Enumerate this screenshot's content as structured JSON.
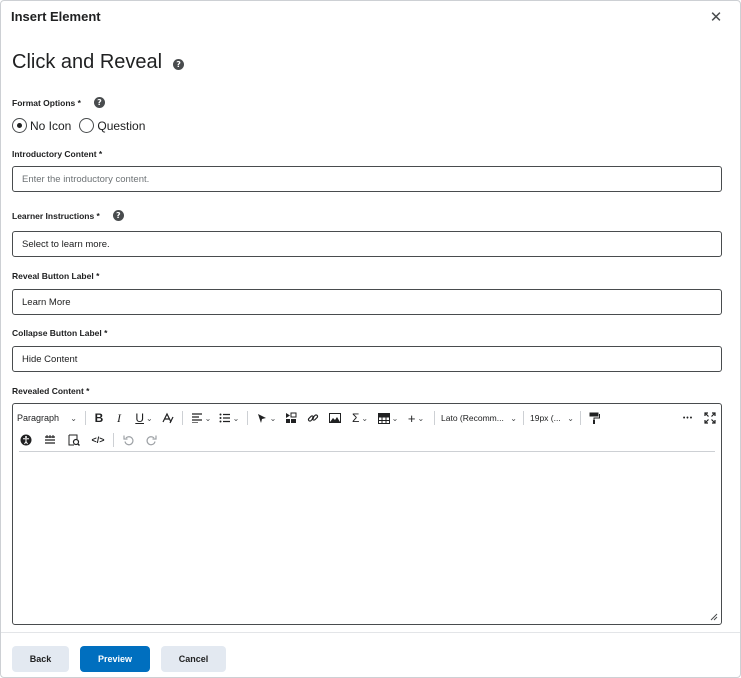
{
  "dialog": {
    "title": "Insert Element",
    "close_icon": "close-icon"
  },
  "heading": {
    "text": "Click and Reveal",
    "help": "?"
  },
  "format_options": {
    "label": "Format Options *",
    "options": [
      {
        "label": "No Icon",
        "selected": true
      },
      {
        "label": "Question",
        "selected": false
      }
    ]
  },
  "intro": {
    "label": "Introductory Content *",
    "placeholder": "Enter the introductory content.",
    "value": ""
  },
  "learner": {
    "label": "Learner Instructions *",
    "value": "Select to learn more."
  },
  "reveal": {
    "label": "Reveal Button Label *",
    "value": "Learn More"
  },
  "collapse": {
    "label": "Collapse Button Label *",
    "value": "Hide Content"
  },
  "revealed": {
    "label": "Revealed Content *",
    "toolbar": {
      "paragraph": "Paragraph",
      "bold": "B",
      "italic": "I",
      "underline": "U",
      "sigma": "Σ",
      "plus": "+",
      "font": "Lato (Recomm...",
      "size": "19px (...",
      "more": "•••"
    }
  },
  "footer": {
    "back": "Back",
    "preview": "Preview",
    "cancel": "Cancel"
  },
  "colors": {
    "primary": "#006fbf",
    "secondary": "#e3e9f1",
    "border": "#494c4e"
  }
}
